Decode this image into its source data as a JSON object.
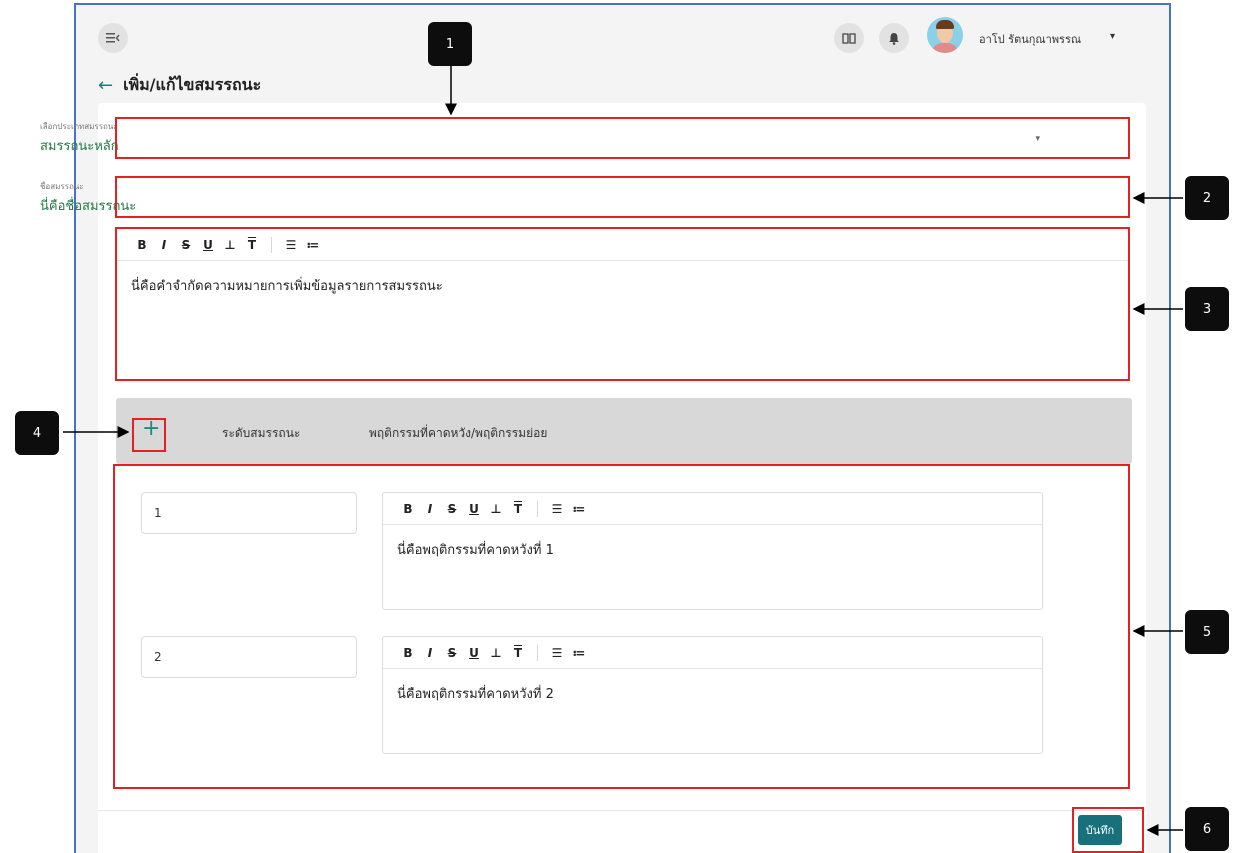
{
  "header": {
    "menu_icon": "collapse-menu-icon",
    "book_icon": "book-icon",
    "bell_icon": "bell-icon",
    "user_name": "อาโป รัตนกุณาพรรณ",
    "user_caret": "▾"
  },
  "page": {
    "back_icon": "←",
    "title": "เพิ่ม/แก้ไขสมรรถนะ"
  },
  "form": {
    "type_label": "เลือกประเภทสมรรถนะ",
    "type_value": "สมรรถนะหลัก",
    "type_caret": "▾",
    "name_label": "ชื่อสมรรถนะ",
    "name_value": "นี่คือชื่อสมรรถนะ",
    "toolbar": {
      "bold": "B",
      "italic": "I",
      "strike": "S",
      "underline": "U",
      "subscript": "⊥",
      "superscript": "T",
      "bullet_list": "☰",
      "numbered_list": "≔"
    },
    "definition_text": "นี่คือคำจำกัดความหมายการเพิ่มข้อมูลรายการสมรรถนะ"
  },
  "levels": {
    "add_icon": "+",
    "col_level": "ระดับสมรรถนะ",
    "col_behavior": "พฤติกรรมที่คาดหวัง/พฤติกรรมย่อย",
    "rows": [
      {
        "level": "1",
        "behavior": "นี่คือพฤติกรรมที่คาดหวังที่ 1"
      },
      {
        "level": "2",
        "behavior": "นี่คือพฤติกรรมที่คาดหวังที่ 2"
      }
    ]
  },
  "actions": {
    "save_label": "บันทึก"
  },
  "annotations": {
    "badges": [
      "1",
      "2",
      "3",
      "4",
      "5",
      "6"
    ],
    "highlight_color": "#e22222",
    "badge_color": "#0d0d0d"
  },
  "colors": {
    "accent": "#18707d",
    "value_text": "#1f7a45",
    "frame_border": "#4a72c4"
  }
}
